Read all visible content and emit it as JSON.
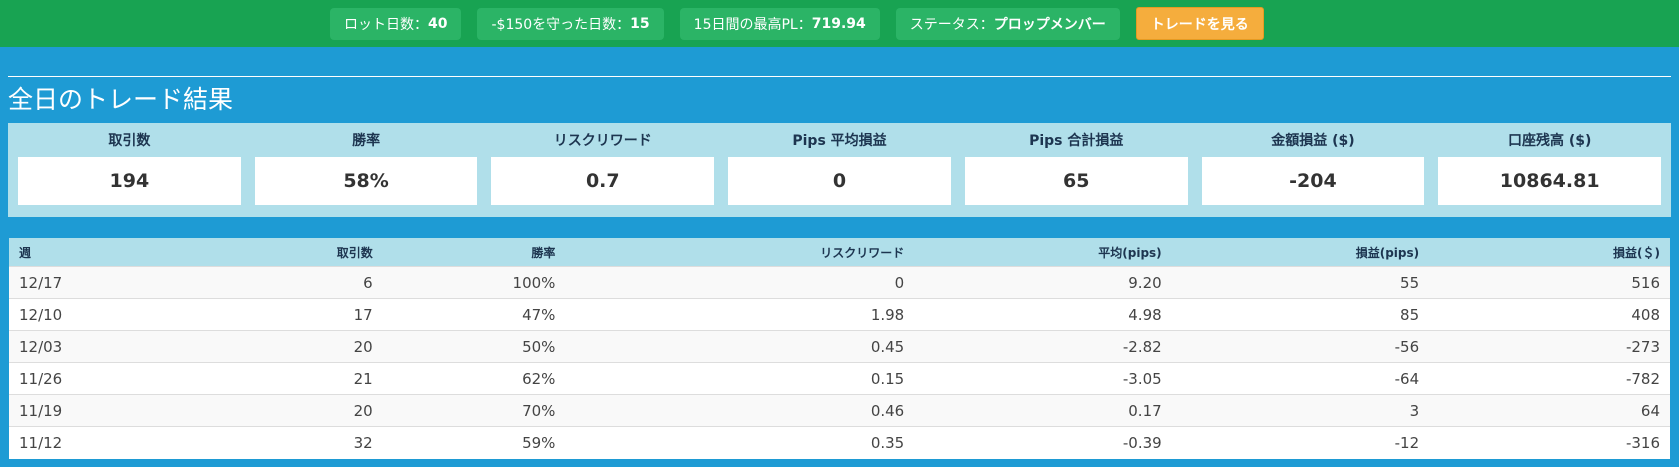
{
  "topbar": {
    "lot_days_label": "ロット日数：",
    "lot_days_value": "40",
    "protected_label": "-$150を守った日数：",
    "protected_value": "15",
    "max_pl_label": "15日間の最高PL：",
    "max_pl_value": "719.94",
    "status_label": "ステータス：",
    "status_value": "プロップメンバー",
    "view_trades_button": "トレードを見る"
  },
  "section": {
    "title": "全日のトレード結果"
  },
  "stats": [
    {
      "label": "取引数",
      "value": "194"
    },
    {
      "label": "勝率",
      "value": "58%"
    },
    {
      "label": "リスクリワード",
      "value": "0.7"
    },
    {
      "label": "Pips 平均損益",
      "value": "0"
    },
    {
      "label": "Pips 合計損益",
      "value": "65"
    },
    {
      "label": "金額損益 ($)",
      "value": "-204"
    },
    {
      "label": "口座残高 ($)",
      "value": "10864.81"
    }
  ],
  "table": {
    "headers": [
      "週",
      "取引数",
      "勝率",
      "リスクリワード",
      "平均(pips)",
      "損益(pips)",
      "損益(＄)"
    ],
    "rows": [
      [
        "12/17",
        "6",
        "100%",
        "0",
        "9.20",
        "55",
        "516"
      ],
      [
        "12/10",
        "17",
        "47%",
        "1.98",
        "4.98",
        "85",
        "408"
      ],
      [
        "12/03",
        "20",
        "50%",
        "0.45",
        "-2.82",
        "-56",
        "-273"
      ],
      [
        "11/26",
        "21",
        "62%",
        "0.15",
        "-3.05",
        "-64",
        "-782"
      ],
      [
        "11/19",
        "20",
        "70%",
        "0.46",
        "0.17",
        "3",
        "64"
      ],
      [
        "11/12",
        "32",
        "59%",
        "0.35",
        "-0.39",
        "-12",
        "-316"
      ]
    ]
  },
  "colors": {
    "topbar_bg": "#18a352",
    "page_bg": "#1e9bd4",
    "header_band": "#b0dfea",
    "button_orange": "#f5ad3d"
  }
}
